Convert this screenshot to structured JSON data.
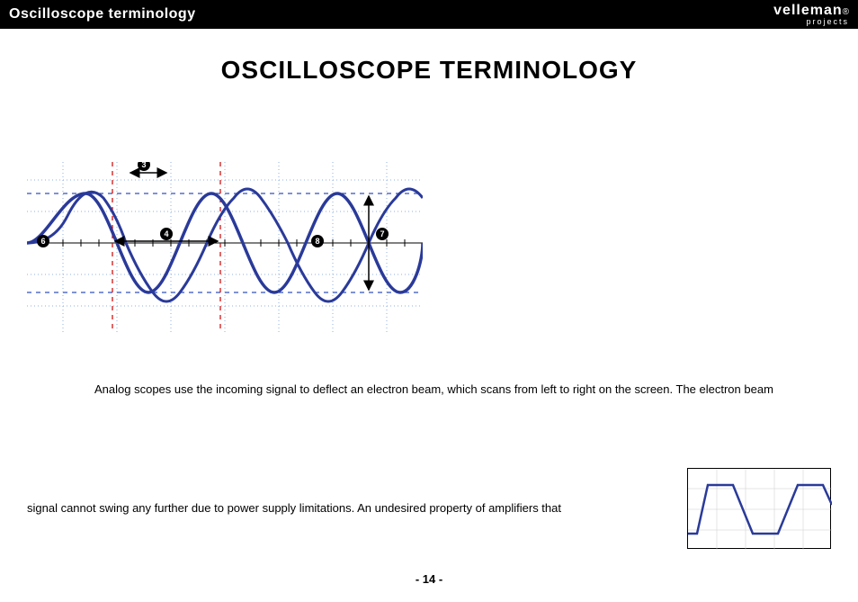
{
  "header": {
    "title": "Oscilloscope terminology",
    "brand_main": "velleman",
    "brand_sub": "projects"
  },
  "page_title": "OSCILLOSCOPE TERMINOLOGY",
  "diagram": {
    "markers": {
      "m3": "3",
      "m4": "4",
      "m6": "6",
      "m7": "7",
      "m8": "8"
    }
  },
  "body": {
    "p1": "Analog scopes use the incoming signal to deflect an electron beam, which scans from left to right on the screen. The electron beam",
    "p2": "signal cannot swing any further due to power supply limitations. An undesired property of amplifiers that"
  },
  "footer": {
    "page_number": "- 14 -"
  }
}
